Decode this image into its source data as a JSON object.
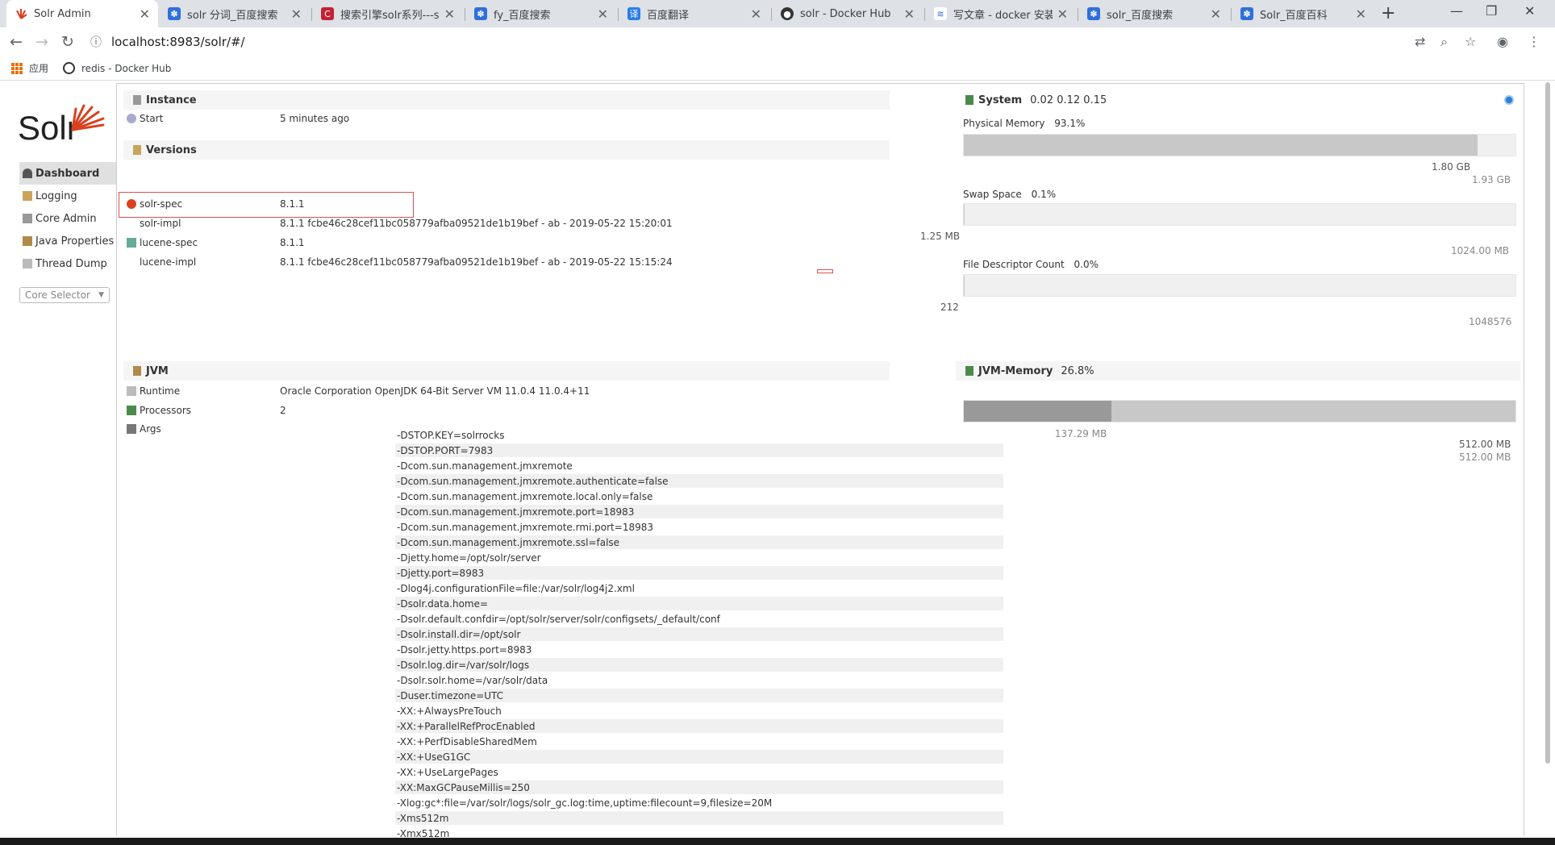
{
  "tabs": [
    {
      "label": "Solr Admin",
      "icon": "solr-icon"
    },
    {
      "label": "solr 分词_百度搜索",
      "icon": "baidu-paw-icon"
    },
    {
      "label": "搜索引擎solr系列---so",
      "icon": "csdn-icon"
    },
    {
      "label": "fy_百度搜索",
      "icon": "baidu-paw-icon"
    },
    {
      "label": "百度翻译",
      "icon": "baidu-translate-icon"
    },
    {
      "label": "solr - Docker Hub",
      "icon": "github-icon"
    },
    {
      "label": "写文章 - docker 安装",
      "icon": "csdn-write-icon"
    },
    {
      "label": "solr_百度搜索",
      "icon": "baidu-paw-icon"
    },
    {
      "label": "Solr_百度百科",
      "icon": "baidu-paw-icon"
    }
  ],
  "address": {
    "url": "localhost:8983/solr/#/"
  },
  "bookmarks": [
    {
      "label": "应用"
    },
    {
      "label": "redis - Docker Hub"
    }
  ],
  "logo": {
    "text": "Solr"
  },
  "nav": [
    {
      "label": "Dashboard",
      "icon": "dashboard-icon"
    },
    {
      "label": "Logging",
      "icon": "logging-icon"
    },
    {
      "label": "Core Admin",
      "icon": "core-admin-icon"
    },
    {
      "label": "Java Properties",
      "icon": "java-properties-icon"
    },
    {
      "label": "Thread Dump",
      "icon": "thread-dump-icon"
    }
  ],
  "core_selector": {
    "placeholder": "Core Selector"
  },
  "instance": {
    "title": "Instance",
    "start_label": "Start",
    "start_value": "5 minutes ago"
  },
  "versions": {
    "title": "Versions",
    "rows": [
      {
        "key": "solr-spec",
        "value": "8.1.1"
      },
      {
        "key": "solr-impl",
        "value": "8.1.1 fcbe46c28cef11bc058779afba09521de1b19bef - ab - 2019-05-22 15:20:01"
      },
      {
        "key": "lucene-spec",
        "value": "8.1.1"
      },
      {
        "key": "lucene-impl",
        "value": "8.1.1 fcbe46c28cef11bc058779afba09521de1b19bef - ab - 2019-05-22 15:15:24"
      }
    ]
  },
  "jvm": {
    "title": "JVM",
    "runtime_label": "Runtime",
    "runtime_value": "Oracle Corporation OpenJDK 64-Bit Server VM 11.0.4 11.0.4+11",
    "processors_label": "Processors",
    "processors_value": "2",
    "args_label": "Args",
    "args": [
      "-DSTOP.KEY=solrrocks",
      "-DSTOP.PORT=7983",
      "-Dcom.sun.management.jmxremote",
      "-Dcom.sun.management.jmxremote.authenticate=false",
      "-Dcom.sun.management.jmxremote.local.only=false",
      "-Dcom.sun.management.jmxremote.port=18983",
      "-Dcom.sun.management.jmxremote.rmi.port=18983",
      "-Dcom.sun.management.jmxremote.ssl=false",
      "-Djetty.home=/opt/solr/server",
      "-Djetty.port=8983",
      "-Dlog4j.configurationFile=file:/var/solr/log4j2.xml",
      "-Dsolr.data.home=",
      "-Dsolr.default.confdir=/opt/solr/server/solr/configsets/_default/conf",
      "-Dsolr.install.dir=/opt/solr",
      "-Dsolr.jetty.https.port=8983",
      "-Dsolr.log.dir=/var/solr/logs",
      "-Dsolr.solr.home=/var/solr/data",
      "-Duser.timezone=UTC",
      "-XX:+AlwaysPreTouch",
      "-XX:+ParallelRefProcEnabled",
      "-XX:+PerfDisableSharedMem",
      "-XX:+UseG1GC",
      "-XX:+UseLargePages",
      "-XX:MaxGCPauseMillis=250",
      "-Xlog:gc*:file=/var/solr/logs/solr_gc.log:time,uptime:filecount=9,filesize=20M",
      "-Xms512m",
      "-Xmx512m"
    ]
  },
  "system": {
    "title": "System",
    "load": "0.02 0.12 0.15",
    "physical_memory": {
      "label": "Physical Memory",
      "percent": "93.1%",
      "fraction": 0.931,
      "used": "1.80 GB",
      "total": "1.93 GB"
    },
    "swap_space": {
      "label": "Swap Space",
      "percent": "0.1%",
      "fraction": 0.001,
      "used": "1.25 MB",
      "total": "1024.00 MB"
    },
    "file_descriptor": {
      "label": "File Descriptor Count",
      "percent": "0.0%",
      "fraction": 0.0002,
      "used": "212",
      "total": "1048576"
    }
  },
  "jvm_memory": {
    "title": "JVM-Memory",
    "percent": "26.8%",
    "used_fraction": 0.268,
    "used": "137.29 MB",
    "max": "512.00 MB",
    "total": "512.00 MB"
  },
  "colors": {
    "accent": "#d9411e",
    "highlight_border": "#d9534f"
  }
}
